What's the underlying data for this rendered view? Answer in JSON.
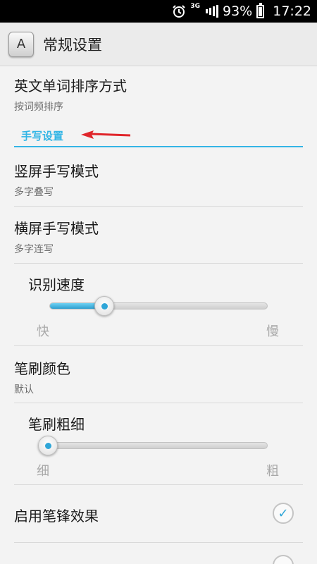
{
  "status_bar": {
    "alarm_icon": "alarm-clock-icon",
    "network": "3G",
    "signal_icon": "signal-bars-icon",
    "battery_percent": "93%",
    "battery_level": 0.93,
    "time": "17:22"
  },
  "action_bar": {
    "app_icon_letter": "A",
    "title": "常规设置"
  },
  "prefs": {
    "sort_mode": {
      "title": "英文单词排序方式",
      "summary": "按词频排序"
    },
    "category": "手写设置",
    "portrait_mode": {
      "title": "竖屏手写模式",
      "summary": "多字叠写"
    },
    "landscape_mode": {
      "title": "横屏手写模式",
      "summary": "多字连写"
    },
    "recognition_speed": {
      "title": "识别速度",
      "min_label": "快",
      "max_label": "慢",
      "value": 0.25
    },
    "brush_color": {
      "title": "笔刷颜色",
      "summary": "默认"
    },
    "brush_width": {
      "title": "笔刷粗细",
      "min_label": "细",
      "max_label": "粗",
      "value": 0.04
    },
    "pen_effect": {
      "title": "启用笔锋效果",
      "checked": true
    }
  },
  "colors": {
    "accent": "#33b5e5",
    "arrow": "#e0262b"
  }
}
